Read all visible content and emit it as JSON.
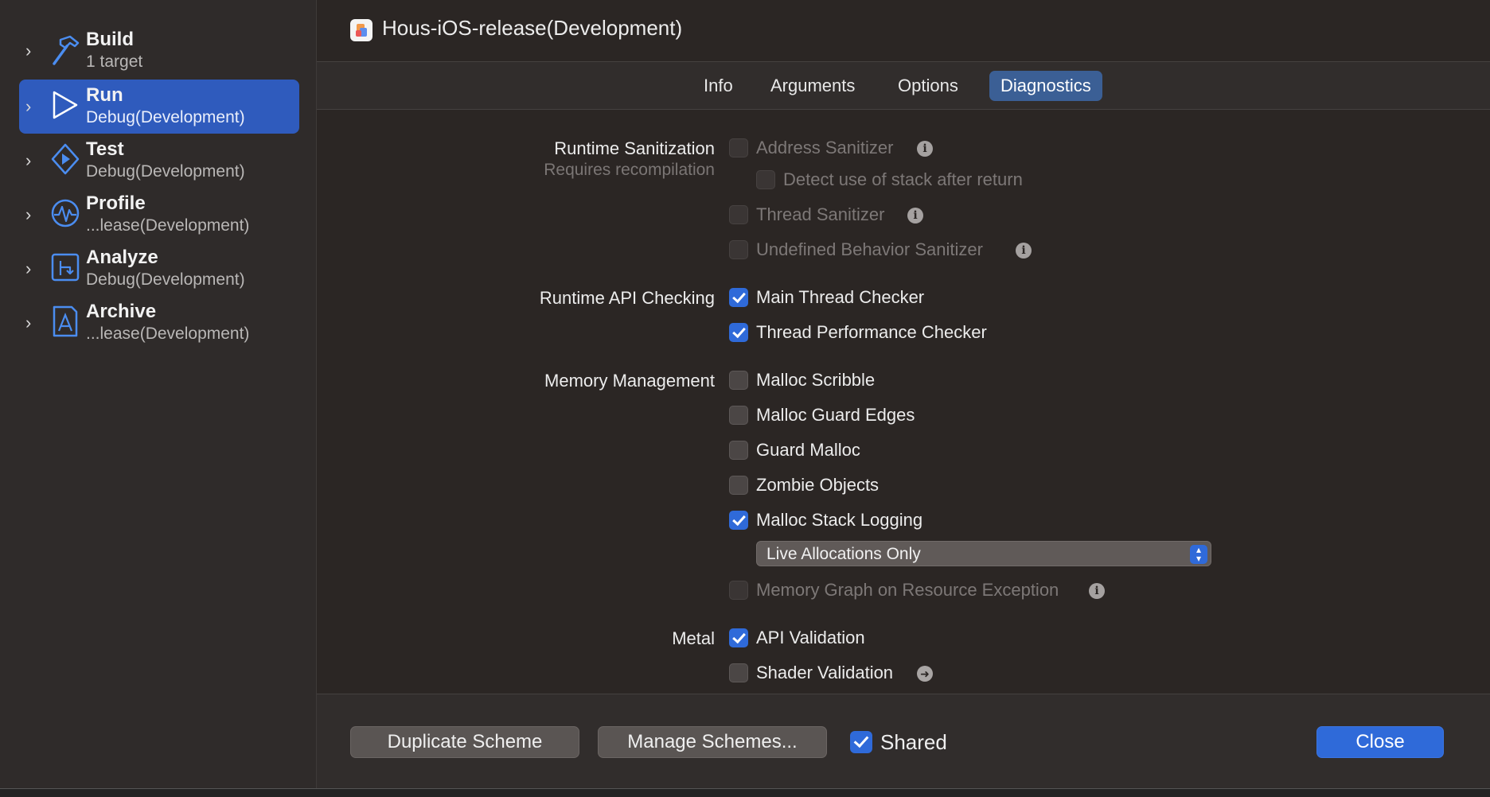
{
  "window": {
    "title": "Hous-iOS-release(Development)"
  },
  "sidebar": {
    "items": [
      {
        "title": "Build",
        "subtitle": "1 target",
        "icon": "hammer-icon",
        "selected": false
      },
      {
        "title": "Run",
        "subtitle": "Debug(Development)",
        "icon": "play-icon",
        "selected": true
      },
      {
        "title": "Test",
        "subtitle": "Debug(Development)",
        "icon": "diamond-play-icon",
        "selected": false
      },
      {
        "title": "Profile",
        "subtitle": "...lease(Development)",
        "icon": "waveform-icon",
        "selected": false
      },
      {
        "title": "Analyze",
        "subtitle": "Debug(Development)",
        "icon": "branch-arrow-icon",
        "selected": false
      },
      {
        "title": "Archive",
        "subtitle": "...lease(Development)",
        "icon": "app-store-icon",
        "selected": false
      }
    ]
  },
  "tabs": {
    "info": "Info",
    "arguments": "Arguments",
    "options": "Options",
    "diagnostics": "Diagnostics",
    "active": "Diagnostics"
  },
  "diagnostics": {
    "runtime_sanitization": {
      "label": "Runtime Sanitization",
      "sublabel": "Requires recompilation",
      "address_sanitizer": {
        "label": "Address Sanitizer",
        "checked": false,
        "enabled": false
      },
      "detect_stack": {
        "label": "Detect use of stack after return",
        "checked": false,
        "enabled": false
      },
      "thread_sanitizer": {
        "label": "Thread Sanitizer",
        "checked": false,
        "enabled": false
      },
      "ub_sanitizer": {
        "label": "Undefined Behavior Sanitizer",
        "checked": false,
        "enabled": false
      }
    },
    "runtime_api_checking": {
      "label": "Runtime API Checking",
      "main_thread_checker": {
        "label": "Main Thread Checker",
        "checked": true
      },
      "thread_performance_checker": {
        "label": "Thread Performance Checker",
        "checked": true
      }
    },
    "memory_management": {
      "label": "Memory Management",
      "malloc_scribble": {
        "label": "Malloc Scribble",
        "checked": false
      },
      "malloc_guard_edges": {
        "label": "Malloc Guard Edges",
        "checked": false
      },
      "guard_malloc": {
        "label": "Guard Malloc",
        "checked": false
      },
      "zombie_objects": {
        "label": "Zombie Objects",
        "checked": false
      },
      "malloc_stack_logging": {
        "label": "Malloc Stack Logging",
        "checked": true
      },
      "stack_logging_mode": "Live Allocations Only",
      "memory_graph": {
        "label": "Memory Graph on Resource Exception",
        "checked": false,
        "enabled": false
      }
    },
    "metal": {
      "label": "Metal",
      "api_validation": {
        "label": "API Validation",
        "checked": true
      },
      "shader_validation": {
        "label": "Shader Validation",
        "checked": false
      }
    }
  },
  "footer": {
    "duplicate": "Duplicate Scheme",
    "manage": "Manage Schemes...",
    "shared": "Shared",
    "shared_checked": true,
    "close": "Close"
  },
  "colors": {
    "accent": "#2f6ad9",
    "selection": "#2f5bbd",
    "background": "#2b2624"
  }
}
